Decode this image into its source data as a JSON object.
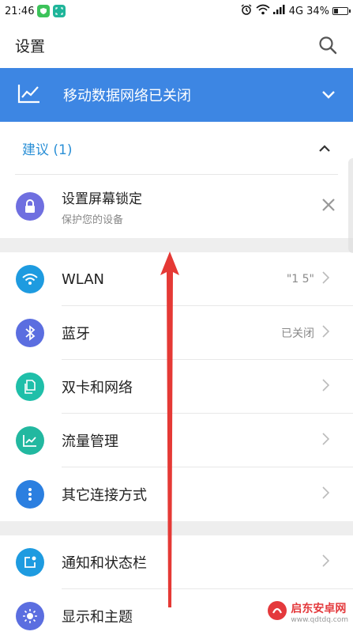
{
  "status": {
    "time": "21:46",
    "network": "4G",
    "battery": "34%"
  },
  "header": {
    "title": "设置"
  },
  "banner": {
    "label": "移动数据网络已关闭"
  },
  "suggestions": {
    "header": "建议 (1)",
    "item": {
      "title": "设置屏幕锁定",
      "subtitle": "保护您的设备"
    }
  },
  "group1": [
    {
      "label": "WLAN",
      "value": "\"1     5\"",
      "icon": "wifi-icon",
      "color": "#1e9be0"
    },
    {
      "label": "蓝牙",
      "value": "已关闭",
      "icon": "bluetooth-icon",
      "color": "#5b6ee0"
    },
    {
      "label": "双卡和网络",
      "value": "",
      "icon": "sim-icon",
      "color": "#1fbfa9"
    },
    {
      "label": "流量管理",
      "value": "",
      "icon": "chart-icon",
      "color": "#22b8a0"
    },
    {
      "label": "其它连接方式",
      "value": "",
      "icon": "more-icon",
      "color": "#2b7fe0"
    }
  ],
  "group2": [
    {
      "label": "通知和状态栏",
      "value": "",
      "icon": "notification-icon",
      "color": "#1e9be0"
    },
    {
      "label": "显示和主题",
      "value": "",
      "icon": "display-icon",
      "color": "#5b6ee0"
    }
  ],
  "watermark": {
    "brand": "启东安卓网",
    "url": "www.qdtdq.com"
  },
  "colors": {
    "banner": "#3d86e3",
    "accent": "#2a8fd6",
    "arrow": "#e53935"
  }
}
